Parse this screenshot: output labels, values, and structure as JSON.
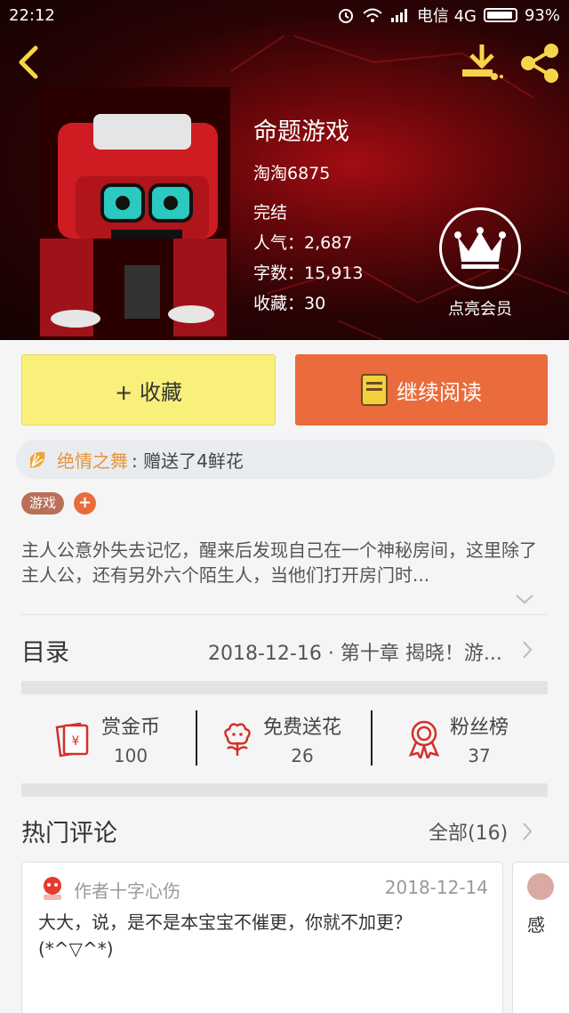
{
  "status_bar": {
    "time": "22:12",
    "carrier": "电信 4G",
    "battery": "93%"
  },
  "book": {
    "title": "命题游戏",
    "author": "淘淘6875",
    "status": "完结",
    "popularity": "人气：2,687",
    "word_count": "字数：15,913",
    "favorites": "收藏：30"
  },
  "vip": {
    "label": "点亮会员"
  },
  "actions": {
    "collect_label": "+ 收藏",
    "continue_label": "继续阅读"
  },
  "gift": {
    "user": "绝情之舞",
    "message": ": 赠送了4鲜花"
  },
  "tags": [
    "游戏"
  ],
  "tag_add": "+",
  "description": "主人公意外失去记忆，醒来后发现自己在一个神秘房间，这里除了主人公，还有另外六个陌生人，当他们打开房门时...",
  "toc": {
    "label": "目录",
    "latest": "2018-12-16 · 第十章 揭晓！游..."
  },
  "functions": [
    {
      "label": "赏金币",
      "value": "100",
      "icon": "coin-icon"
    },
    {
      "label": "免费送花",
      "value": "26",
      "icon": "flower-icon"
    },
    {
      "label": "粉丝榜",
      "value": "37",
      "icon": "medal-icon"
    }
  ],
  "comments_section": {
    "title": "热门评论",
    "all_label": "全部(16)"
  },
  "comments": [
    {
      "author": "作者十字心伤",
      "date": "2018-12-14",
      "text": "大大，说，是不是本宝宝不催更，你就不加更？(*^▽^*)"
    },
    {
      "text": "感"
    }
  ],
  "colors": {
    "accent_orange": "#ea6b3c",
    "collect_yellow": "#f8f07a",
    "gift_user": "#e6943a",
    "icon_red": "#d2312a"
  }
}
